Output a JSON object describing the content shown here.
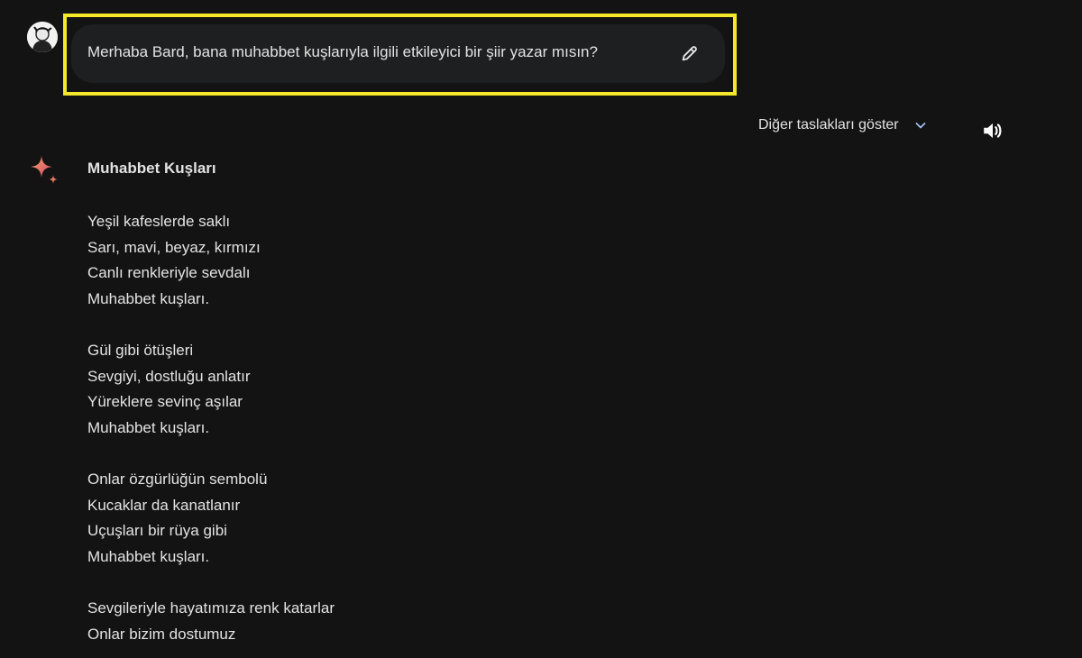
{
  "conversation": {
    "user_prompt": "Merhaba Bard, bana muhabbet kuşlarıyla ilgili etkileyici bir şiir yazar mısın?",
    "drafts_label": "Diğer taslakları göster",
    "response": {
      "title": "Muhabbet Kuşları",
      "stanzas": [
        [
          "Yeşil kafeslerde saklı",
          "Sarı, mavi, beyaz, kırmızı",
          "Canlı renkleriyle sevdalı",
          "Muhabbet kuşları."
        ],
        [
          "Gül gibi ötüşleri",
          "Sevgiyi, dostluğu anlatır",
          "Yüreklere sevinç aşılar",
          "Muhabbet kuşları."
        ],
        [
          "Onlar özgürlüğün sembolü",
          "Kucaklar da kanatlanır",
          "Uçuşları bir rüya gibi",
          "Muhabbet kuşları."
        ],
        [
          "Sevgileriyle hayatımıza renk katarlar",
          "Onlar bizim dostumuz"
        ]
      ]
    }
  },
  "icons": {
    "avatar": "user-avatar",
    "edit": "pencil-icon",
    "chevron": "chevron-down-icon",
    "speaker": "speaker-icon",
    "assistant": "sparkle-icon"
  },
  "colors": {
    "background": "#131314",
    "bubble": "#1e1f20",
    "highlight": "#f5e72a",
    "text": "#e3e3e3"
  }
}
